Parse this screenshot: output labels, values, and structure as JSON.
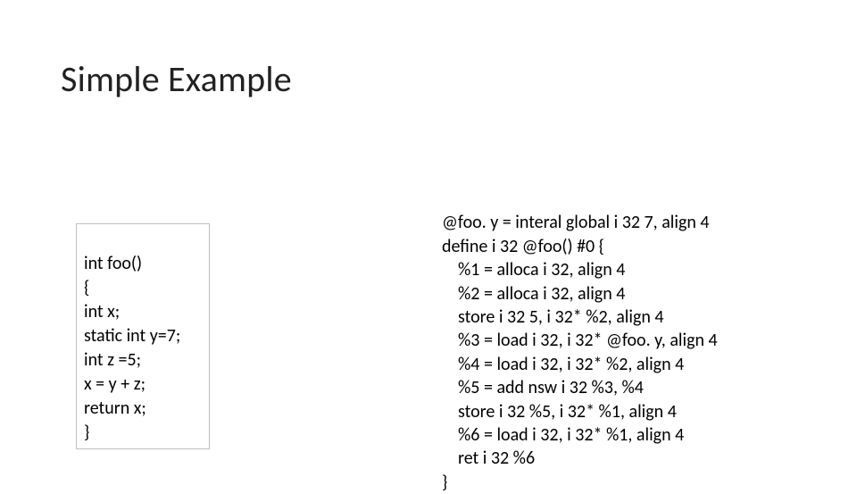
{
  "title": "Simple Example",
  "source_code": {
    "l1": "int foo()",
    "l2": "{",
    "l3": "int x;",
    "l4": "static int y=7;",
    "l5": "int z =5;",
    "l6": "x = y + z;",
    "l7": "return x;",
    "l8": "}"
  },
  "ir_code": {
    "l1": "@foo. y = interal global i 32 7, align 4",
    "l2": "define i 32 @foo() #0 {",
    "l3": "%1 = alloca i 32, align 4",
    "l4": "%2 = alloca i 32, align 4",
    "l5": "store i 32 5, i 32* %2, align 4",
    "l6": "%3 = load i 32, i 32* @foo. y, align 4",
    "l7": "%4 = load i 32, i 32* %2, align 4",
    "l8": "%5 = add nsw i 32 %3, %4",
    "l9": "store i 32 %5, i 32* %1, align 4",
    "l10": "%6 = load i 32, i 32* %1, align 4",
    "l11": "ret i 32 %6",
    "l12": "}"
  }
}
